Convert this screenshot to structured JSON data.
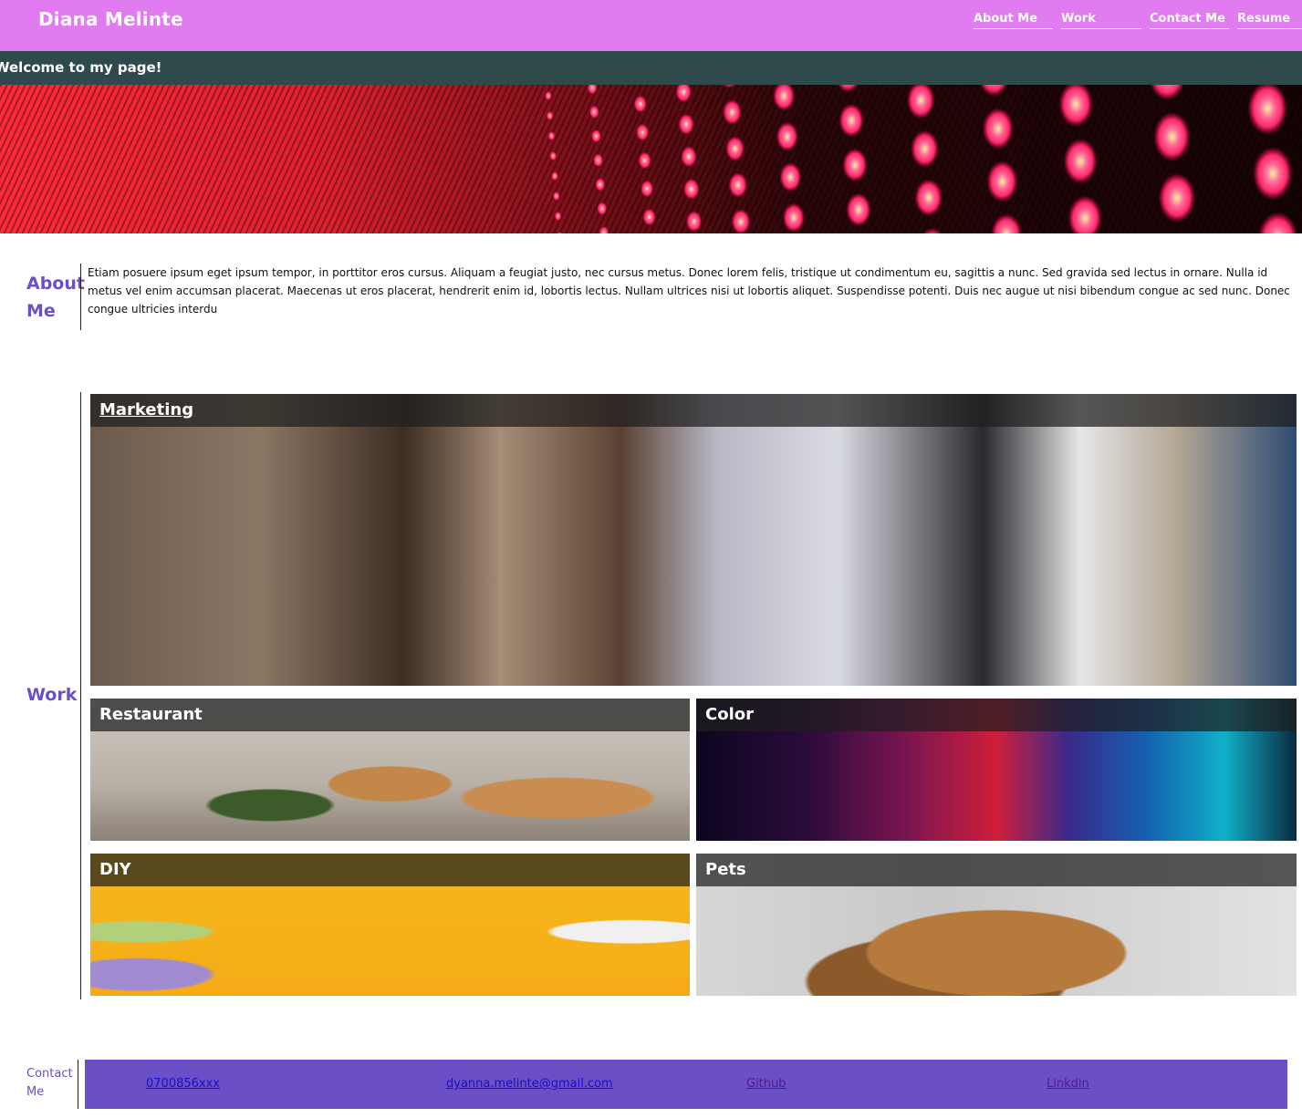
{
  "header": {
    "brand": "Diana Melinte",
    "nav": [
      "About Me",
      "Work",
      "Contact Me",
      "Resume"
    ]
  },
  "welcome": "Welcome to my page!",
  "about": {
    "label_line1": "About",
    "label_line2": "Me",
    "text": "Etiam posuere ipsum eget ipsum tempor, in porttitor eros cursus. Aliquam a feugiat justo, nec cursus metus. Donec lorem felis, tristique ut condimentum eu, sagittis a nunc. Sed gravida sed lectus in ornare. Nulla id metus vel enim accumsan placerat. Maecenas ut eros placerat, hendrerit enim id, lobortis lectus. Nullam ultrices nisi ut lobortis aliquet. Suspendisse potenti. Duis nec augue ut nisi bibendum congue ac sed nunc. Donec congue ultricies interdu"
  },
  "work": {
    "label": "Work",
    "tiles": [
      "Marketing",
      "Restaurant",
      "Color",
      "DIY",
      "Pets"
    ]
  },
  "contact": {
    "label_line1": "Contact",
    "label_line2": "Me",
    "phone": "0700856xxx",
    "email": "dyanna.melinte@gmail.com",
    "github": "Github",
    "linkedin": "Linkdin"
  },
  "colors": {
    "header_bg": "#e07bf0",
    "welcome_bg": "#2f4a4a",
    "accent_purple": "#6a4fc6"
  }
}
